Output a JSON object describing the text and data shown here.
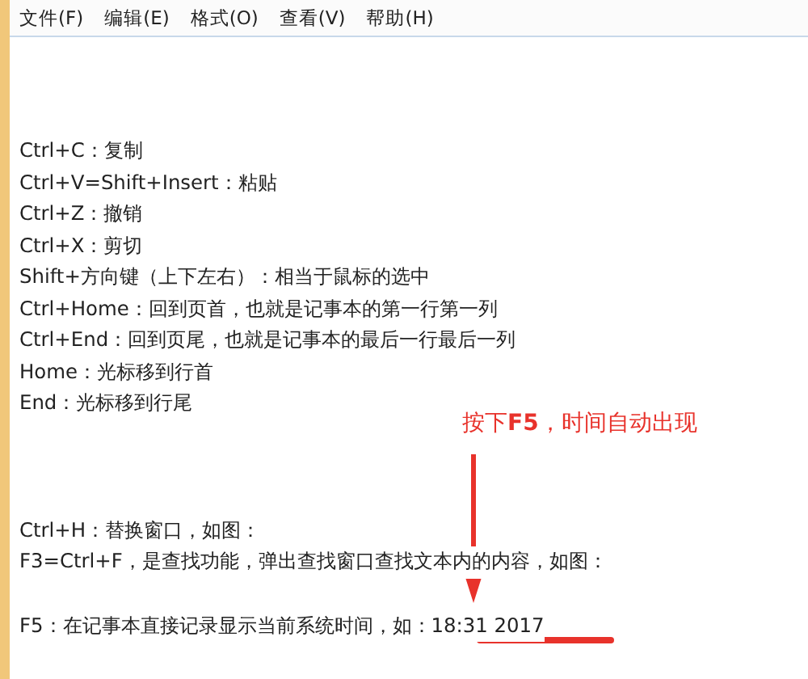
{
  "menu": [
    "文件(F)",
    "编辑(E)",
    "格式(O)",
    "查看(V)",
    "帮助(H)"
  ],
  "paragraphs": [
    [
      "Ctrl+C：复制",
      "Ctrl+V=Shift+Insert：粘贴",
      "Ctrl+Z：撤销",
      "Ctrl+X：剪切",
      "Shift+方向键（上下左右）：相当于鼠标的选中",
      "Ctrl+Home：回到页首，也就是记事本的第一行第一列",
      "Ctrl+End：回到页尾，也就是记事本的最后一行最后一列",
      "Home：光标移到行首",
      "End：光标移到行尾"
    ],
    [
      "Ctrl+H：替换窗口，如图：",
      "F3=Ctrl+F，是查找功能，弹出查找窗口查找文本内的内容，如图："
    ],
    [
      "F5：在记事本直接记录显示当前系统时间，如：18:31 2017"
    ]
  ],
  "annotation": "按下**F5**，时间自动出现"
}
